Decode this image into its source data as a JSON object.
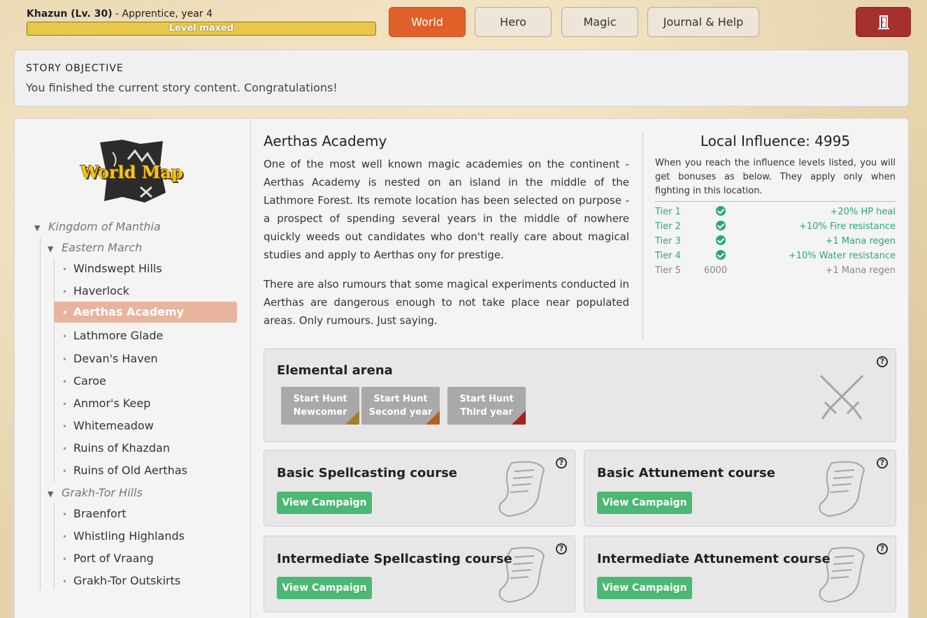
{
  "hero": {
    "name": "Khazun (Lv. 30)",
    "subtitle": " - Apprentice, year 4",
    "level_bar": "Level maxed",
    "level_progress": 1.0
  },
  "nav": {
    "world": "World",
    "hero": "Hero",
    "magic": "Magic",
    "journal": "Journal & Help",
    "exit_icon": "door-exit-icon"
  },
  "story": {
    "heading": "STORY OBJECTIVE",
    "text": "You finished the current story content. Congratulations!"
  },
  "map": {
    "logo_text": "World Map",
    "tree": {
      "kingdom": "Kingdom of Manthia",
      "region1": "Eastern March",
      "region1_places": [
        "Windswept Hills",
        "Haverlock",
        "Aerthas Academy",
        "Lathmore Glade",
        "Devan's Haven",
        "Caroe",
        "Anmor's Keep",
        "Whitemeadow",
        "Ruins of Khazdan",
        "Ruins of Old Aerthas"
      ],
      "region2": "Grakh-Tor Hills",
      "region2_places": [
        "Braenfort",
        "Whistling Highlands",
        "Port of Vraang",
        "Grakh-Tor Outskirts"
      ],
      "selected": "Aerthas Academy"
    }
  },
  "location": {
    "title": "Aerthas Academy",
    "desc1": "One of the most well known magic academies on the continent - Aerthas Academy is nested on an island in the middle of the Lathmore Forest. Its remote location has been selected on purpose - a prospect of spending several years in the middle of nowhere quickly weeds out candidates who don't really care about magical studies and apply to Aerthas ony for prestige.",
    "desc2": "There are also rumours that some magical experiments conducted in Aerthas are dangerous enough to not take place near populated areas. Only rumours. Just saying."
  },
  "influence": {
    "title": "Local Influence: 4995",
    "note": "When you reach the influence levels listed, you will get bonuses as below. They apply only when fighting in this location.",
    "tiers": [
      {
        "name": "Tier 1",
        "status": "done",
        "bonus": "+20% HP heal"
      },
      {
        "name": "Tier 2",
        "status": "done",
        "bonus": "+10% Fire resistance"
      },
      {
        "name": "Tier 3",
        "status": "done",
        "bonus": "+1 Mana regen"
      },
      {
        "name": "Tier 4",
        "status": "done",
        "bonus": "+10% Water resistance"
      },
      {
        "name": "Tier 5",
        "status": "pending",
        "requirement": "6000",
        "bonus": "+1 Mana regen"
      }
    ]
  },
  "arena": {
    "title": "Elemental arena",
    "help": "?",
    "hunts": [
      {
        "line1": "Start Hunt",
        "line2": "Newcomer",
        "color": "#a3802a"
      },
      {
        "line1": "Start Hunt",
        "line2": "Second year",
        "color": "#b5621e"
      },
      {
        "line1": "Start Hunt",
        "line2": "Third year",
        "color": "#a1221e"
      }
    ]
  },
  "courses": [
    {
      "title": "Basic Spellcasting course",
      "button": "View Campaign"
    },
    {
      "title": "Basic Attunement course",
      "button": "View Campaign"
    },
    {
      "title": "Intermediate Spellcasting course",
      "button": "View Campaign"
    },
    {
      "title": "Intermediate Attunement course",
      "button": "View Campaign"
    }
  ],
  "colors": {
    "accent_active": "#e0602a",
    "exit": "#a6302e",
    "success": "#2aa77a",
    "campaign_button": "#4bb873",
    "selected_place": "#e8b49e"
  }
}
